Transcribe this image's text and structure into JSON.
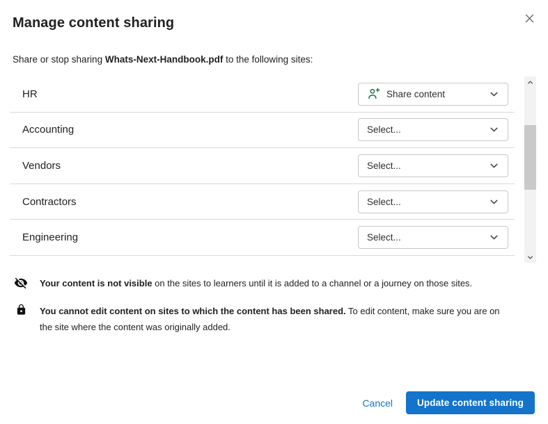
{
  "dialog": {
    "title": "Manage content sharing",
    "subtitle_prefix": "Share or stop sharing ",
    "subtitle_filename": "Whats-Next-Handbook.pdf",
    "subtitle_suffix": " to the following sites:"
  },
  "sites": [
    {
      "name": "HR",
      "selection": "Share content"
    },
    {
      "name": "Accounting",
      "selection": "Select..."
    },
    {
      "name": "Vendors",
      "selection": "Select..."
    },
    {
      "name": "Contractors",
      "selection": "Select..."
    },
    {
      "name": "Engineering",
      "selection": "Select..."
    }
  ],
  "notes": [
    {
      "icon": "eye-off-icon",
      "bold": "Your content is not visible",
      "rest": " on the sites to learners until it is added to a channel or a journey on those sites."
    },
    {
      "icon": "lock-icon",
      "bold": "You cannot edit content on sites to which the content has been shared.",
      "rest": " To edit content, make sure you are on the site where the content was originally added."
    }
  ],
  "footer": {
    "cancel_label": "Cancel",
    "submit_label": "Update content sharing"
  },
  "colors": {
    "accent_blue": "#1473cb",
    "icon_green": "#1e7b4f",
    "text_dark": "#212121",
    "divider": "#d9d9d9",
    "control_border": "#c7c7c7",
    "scroll_track": "#f2f2f2",
    "scroll_thumb": "#c9c9c9"
  }
}
